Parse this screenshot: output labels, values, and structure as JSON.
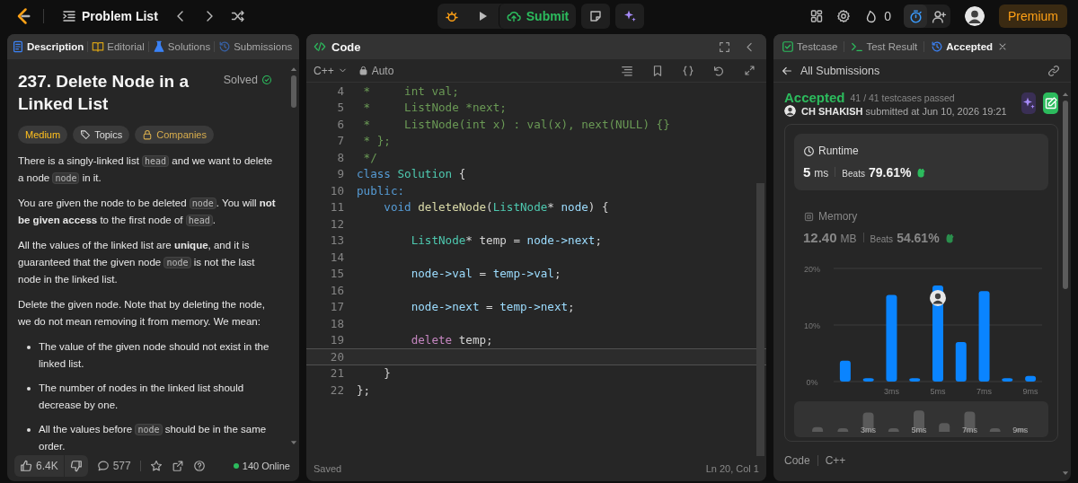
{
  "top_bar": {
    "nav_title": "Problem List",
    "submit_label": "Submit",
    "streak": "0",
    "premium_label": "Premium"
  },
  "description_panel": {
    "tabs": [
      {
        "label": "Description",
        "kind": "description",
        "selected": true
      },
      {
        "label": "Editorial",
        "kind": "editorial",
        "selected": false
      },
      {
        "label": "Solutions",
        "kind": "solutions",
        "selected": false
      },
      {
        "label": "Submissions",
        "kind": "submissions",
        "selected": false
      }
    ],
    "title": "237. Delete Node in a Linked List",
    "status": "Solved",
    "tags": [
      {
        "kind": "difficulty",
        "label": "Medium"
      },
      {
        "kind": "topics",
        "label": "Topics"
      },
      {
        "kind": "companies",
        "label": "Companies"
      }
    ],
    "paragraphs": [
      [
        {
          "kind": "text",
          "text": "There is a singly-linked list "
        },
        {
          "kind": "code",
          "text": "head"
        },
        {
          "kind": "text",
          "text": " and we want to delete a node "
        },
        {
          "kind": "code",
          "text": "node"
        },
        {
          "kind": "text",
          "text": " in it."
        }
      ],
      [
        {
          "kind": "text",
          "text": "You are given the node to be deleted "
        },
        {
          "kind": "code",
          "text": "node"
        },
        {
          "kind": "text",
          "text": ". You will "
        },
        {
          "kind": "bold",
          "text": "not be given access"
        },
        {
          "kind": "text",
          "text": " to the first node of "
        },
        {
          "kind": "code",
          "text": "head"
        },
        {
          "kind": "text",
          "text": "."
        }
      ],
      [
        {
          "kind": "text",
          "text": "All the values of the linked list are "
        },
        {
          "kind": "bold",
          "text": "unique"
        },
        {
          "kind": "text",
          "text": ", and it is guaranteed that the given node "
        },
        {
          "kind": "code",
          "text": "node"
        },
        {
          "kind": "text",
          "text": " is not the last node in the linked list."
        }
      ],
      [
        {
          "kind": "text",
          "text": "Delete the given node. Note that by deleting the node, we do not mean removing it from memory. We mean:"
        }
      ]
    ],
    "bullets": [
      [
        {
          "kind": "text",
          "text": "The value of the given node should not exist in the linked list."
        }
      ],
      [
        {
          "kind": "text",
          "text": "The number of nodes in the linked list should decrease by one."
        }
      ],
      [
        {
          "kind": "text",
          "text": "All the values before "
        },
        {
          "kind": "code",
          "text": "node"
        },
        {
          "kind": "text",
          "text": " should be in the same order."
        }
      ]
    ],
    "footer": {
      "likes": "6.4K",
      "comments": "577",
      "online": "140 Online"
    }
  },
  "code_panel": {
    "title": "Code",
    "language": "C++",
    "mode": "Auto",
    "status": "Saved",
    "cursor": "Ln 20, Col 1",
    "lines": [
      {
        "number": "4",
        "current": false,
        "tokens": [
          {
            "kind": "comment",
            "text": " *     int val;"
          }
        ]
      },
      {
        "number": "5",
        "current": false,
        "tokens": [
          {
            "kind": "comment",
            "text": " *     ListNode *next;"
          }
        ]
      },
      {
        "number": "6",
        "current": false,
        "tokens": [
          {
            "kind": "comment",
            "text": " *     ListNode(int x) : val(x), next(NULL) {}"
          }
        ]
      },
      {
        "number": "7",
        "current": false,
        "tokens": [
          {
            "kind": "comment",
            "text": " * };"
          }
        ]
      },
      {
        "number": "8",
        "current": false,
        "tokens": [
          {
            "kind": "comment",
            "text": " */"
          }
        ]
      },
      {
        "number": "9",
        "current": false,
        "tokens": [
          {
            "kind": "keyword",
            "text": "class"
          },
          {
            "kind": "type",
            "text": " Solution"
          },
          {
            "kind": "plain",
            "text": " {"
          }
        ]
      },
      {
        "number": "10",
        "current": false,
        "tokens": [
          {
            "kind": "keyword",
            "text": "public:"
          }
        ]
      },
      {
        "number": "11",
        "current": false,
        "tokens": [
          {
            "kind": "keyword",
            "text": "    void"
          },
          {
            "kind": "function",
            "text": " deleteNode"
          },
          {
            "kind": "plain",
            "text": "("
          },
          {
            "kind": "type",
            "text": "ListNode"
          },
          {
            "kind": "plain",
            "text": "* "
          },
          {
            "kind": "variable",
            "text": "node"
          },
          {
            "kind": "plain",
            "text": ") {"
          }
        ]
      },
      {
        "number": "12",
        "current": false
      },
      {
        "number": "13",
        "current": false,
        "tokens": [
          {
            "kind": "type",
            "text": "        ListNode"
          },
          {
            "kind": "plain",
            "text": "* temp = "
          },
          {
            "kind": "variable",
            "text": "node->next"
          },
          {
            "kind": "plain",
            "text": ";"
          }
        ]
      },
      {
        "number": "14",
        "current": false
      },
      {
        "number": "15",
        "current": false,
        "tokens": [
          {
            "kind": "variable",
            "text": "        node->val"
          },
          {
            "kind": "plain",
            "text": " = "
          },
          {
            "kind": "variable",
            "text": "temp->val"
          },
          {
            "kind": "plain",
            "text": ";"
          }
        ]
      },
      {
        "number": "16",
        "current": false
      },
      {
        "number": "17",
        "current": false,
        "tokens": [
          {
            "kind": "variable",
            "text": "        node->next"
          },
          {
            "kind": "plain",
            "text": " = "
          },
          {
            "kind": "variable",
            "text": "temp->next"
          },
          {
            "kind": "plain",
            "text": ";"
          }
        ]
      },
      {
        "number": "18",
        "current": false
      },
      {
        "number": "19",
        "current": false,
        "tokens": [
          {
            "kind": "control",
            "text": "        delete"
          },
          {
            "kind": "plain",
            "text": " temp;"
          }
        ]
      },
      {
        "number": "20",
        "current": true
      },
      {
        "number": "21",
        "current": false,
        "tokens": [
          {
            "kind": "plain",
            "text": "    }"
          }
        ]
      },
      {
        "number": "22",
        "current": false,
        "tokens": [
          {
            "kind": "plain",
            "text": "};"
          }
        ]
      }
    ]
  },
  "result_panel": {
    "tabs": [
      {
        "label": "Testcase",
        "kind": "testcase",
        "selected": false
      },
      {
        "label": "Test Result",
        "kind": "result",
        "selected": false
      },
      {
        "label": "Accepted",
        "kind": "accepted",
        "selected": true
      }
    ],
    "back_label": "All Submissions",
    "verdict": "Accepted",
    "passed": "41 / 41 testcases passed",
    "submitted": "**CH SHAKISH** submitted at Jun 10, 2026 19:21",
    "stats": [
      {
        "kind": "runtime",
        "label": "Runtime",
        "value": "5",
        "unit": "ms",
        "beats_label": "Beats",
        "beats": "79.61%",
        "selected": true
      },
      {
        "kind": "memory",
        "label": "Memory",
        "value": "12.40",
        "unit": "MB",
        "beats_label": "Beats",
        "beats": "54.61%",
        "selected": false
      }
    ],
    "distribution": {
      "overview_labels": [
        "3ms",
        "5ms",
        "7ms",
        "9ms"
      ],
      "bars": [
        {
          "selected": false
        },
        {
          "selected": false
        },
        {
          "selected": false
        },
        {
          "selected": false
        },
        {
          "selected": true
        },
        {
          "selected": false
        },
        {
          "selected": false
        },
        {
          "selected": false
        },
        {
          "selected": false
        }
      ],
      "chart_data": {
        "type": "bar",
        "x": [
          1,
          2,
          3,
          4,
          5,
          6,
          7,
          8,
          9
        ],
        "series": [
          {
            "color": "#0a84ff",
            "values": [
              3.7,
              0.6,
              15.3,
              0.6,
              17,
              7,
              16,
              0.6,
              1
            ]
          }
        ],
        "xlim": [
          0.5,
          9.5
        ],
        "ylim": [
          0,
          20
        ],
        "yticks": [
          {
            "value": 0,
            "label": "0%"
          },
          {
            "value": 10,
            "label": "10%"
          },
          {
            "value": 20,
            "label": "20%"
          }
        ],
        "xticks": [
          {
            "value": 3,
            "label": "3ms"
          },
          {
            "value": 5,
            "label": "5ms"
          },
          {
            "value": 7,
            "label": "7ms"
          },
          {
            "value": 9,
            "label": "9ms"
          }
        ]
      }
    },
    "code_label": "Code",
    "code_language": "C++"
  }
}
